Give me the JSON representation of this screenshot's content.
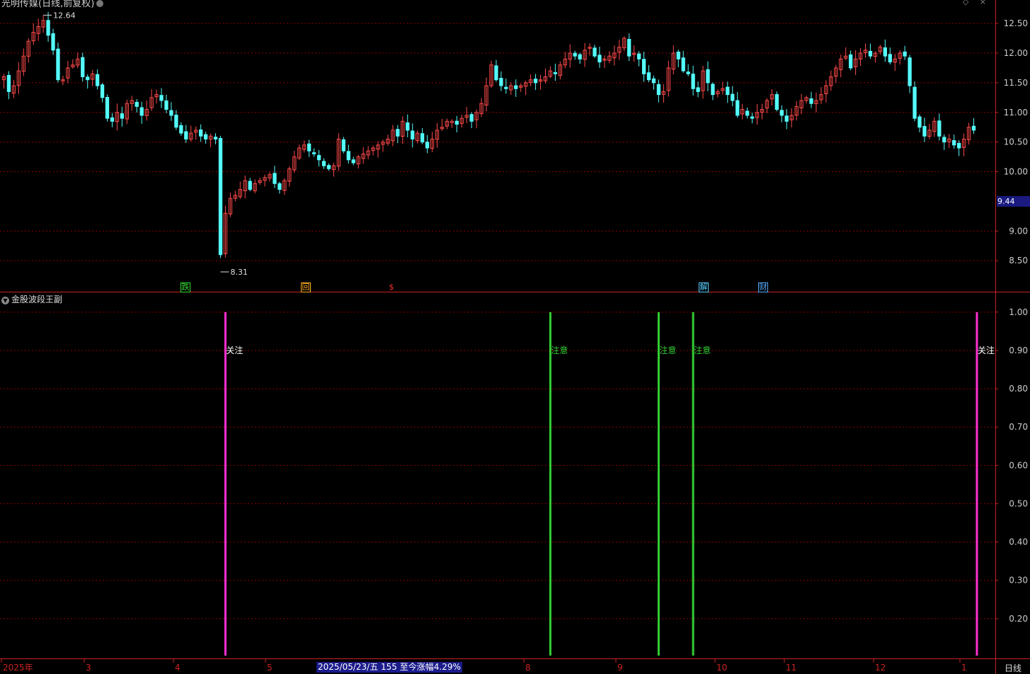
{
  "window": {
    "title": "光明传媒(日线,前复权)",
    "controls_label": "◇ ×"
  },
  "colors": {
    "background": "#000000",
    "up": "#ff4a4a",
    "down": "#54fcfc",
    "grid": "#8b0000",
    "axis": "#cc2222",
    "magenta": "#ff2fd2",
    "green": "#33cc33",
    "tag_bg": "#1a1a80"
  },
  "main_chart": {
    "high_label": "12.64",
    "low_label": "8.31",
    "current_price_tag": "9.44",
    "y_ticks": [
      "12.50",
      "12.00",
      "11.50",
      "11.00",
      "10.50",
      "10.00",
      "9.00",
      "8.50"
    ],
    "event_badges": [
      {
        "label": "跌",
        "color": "#33dd33",
        "name": "badge-die"
      },
      {
        "label": "回",
        "color": "#ffaa22",
        "name": "badge-hui"
      },
      {
        "label": "$",
        "color": "#ff3333",
        "name": "badge-dollar"
      },
      {
        "label": "解",
        "color": "#55ccff",
        "name": "badge-jie"
      },
      {
        "label": "财",
        "color": "#55aaff",
        "name": "badge-cai"
      }
    ]
  },
  "sub_chart": {
    "title": "金股波段王副",
    "y_ticks": [
      "1.00",
      "0.90",
      "0.80",
      "0.70",
      "0.60",
      "0.50",
      "0.40",
      "0.30",
      "0.20"
    ],
    "signals": [
      {
        "label": "关注",
        "color": "magenta",
        "value": 1.0
      },
      {
        "label": "注意",
        "color": "green",
        "value": 1.0
      },
      {
        "label": "注意",
        "color": "green",
        "value": 1.0
      },
      {
        "label": "注意",
        "color": "green",
        "value": 1.0
      },
      {
        "label": "关注",
        "color": "magenta",
        "value": 1.0
      }
    ]
  },
  "x_axis": {
    "labels": [
      "2025年",
      "3",
      "4",
      "5",
      "8",
      "9",
      "10",
      "11",
      "12",
      "1"
    ]
  },
  "status_bar": {
    "info": "2025/05/23/五 155 至今涨幅4.29%",
    "period": "日线"
  },
  "chart_data": {
    "type": "candlestick",
    "description_series": "daily OHLC closes (approx., read from price axis)",
    "closes": [
      11.6,
      11.35,
      11.45,
      11.7,
      11.95,
      12.2,
      12.35,
      12.45,
      12.55,
      12.3,
      12.05,
      11.55,
      11.55,
      11.75,
      11.8,
      11.9,
      11.6,
      11.55,
      11.65,
      11.45,
      11.25,
      10.9,
      10.85,
      11.0,
      10.9,
      11.15,
      11.2,
      11.1,
      10.95,
      11.05,
      11.25,
      11.3,
      11.2,
      11.05,
      10.95,
      10.75,
      10.65,
      10.55,
      10.65,
      10.7,
      10.6,
      10.55,
      10.6,
      10.55,
      8.6,
      9.3,
      9.55,
      9.6,
      9.7,
      9.85,
      9.7,
      9.8,
      9.85,
      9.9,
      9.95,
      9.8,
      9.7,
      9.85,
      10.05,
      10.25,
      10.4,
      10.45,
      10.35,
      10.3,
      10.2,
      10.1,
      10.05,
      10.1,
      10.55,
      10.35,
      10.2,
      10.15,
      10.25,
      10.3,
      10.35,
      10.4,
      10.45,
      10.5,
      10.55,
      10.7,
      10.6,
      10.85,
      10.7,
      10.55,
      10.65,
      10.5,
      10.4,
      10.55,
      10.7,
      10.75,
      10.85,
      10.85,
      10.8,
      10.9,
      10.95,
      10.85,
      11.0,
      11.15,
      11.45,
      11.8,
      11.55,
      11.45,
      11.4,
      11.45,
      11.4,
      11.45,
      11.5,
      11.55,
      11.5,
      11.55,
      11.6,
      11.7,
      11.65,
      11.8,
      11.9,
      12.0,
      11.95,
      11.9,
      12.05,
      12.1,
      11.95,
      11.85,
      11.9,
      11.95,
      12.0,
      12.1,
      12.25,
      11.95,
      12.0,
      11.9,
      11.65,
      11.55,
      11.5,
      11.3,
      11.35,
      11.75,
      12.0,
      11.9,
      11.7,
      11.65,
      11.4,
      11.35,
      11.7,
      11.5,
      11.3,
      11.35,
      11.4,
      11.3,
      11.2,
      10.95,
      11.05,
      10.95,
      10.9,
      11.0,
      11.05,
      11.2,
      11.3,
      11.05,
      10.95,
      10.85,
      10.95,
      11.1,
      11.2,
      11.25,
      11.15,
      11.2,
      11.3,
      11.45,
      11.6,
      11.75,
      11.9,
      11.95,
      11.75,
      11.9,
      12.0,
      12.05,
      11.95,
      12.0,
      12.1,
      11.95,
      11.85,
      11.9,
      12.0,
      11.95,
      11.45,
      10.9,
      10.75,
      10.6,
      10.7,
      10.85,
      10.6,
      10.5,
      10.55,
      10.45,
      10.4,
      10.55,
      10.75,
      10.7
    ],
    "y_range": [
      8.0,
      12.8
    ],
    "extremes": {
      "high": 12.64,
      "low": 8.31
    },
    "indicator": {
      "name": "金股波段王副",
      "y_range": [
        0.1,
        1.02
      ],
      "signal_bars": [
        {
          "index": 45,
          "label": "关注",
          "value": 1.0
        },
        {
          "index": 111,
          "label": "注意",
          "value": 1.0
        },
        {
          "index": 133,
          "label": "注意",
          "value": 1.0
        },
        {
          "index": 140,
          "label": "注意",
          "value": 1.0
        },
        {
          "index": 227,
          "label": "关注",
          "value": 1.0
        }
      ]
    }
  }
}
